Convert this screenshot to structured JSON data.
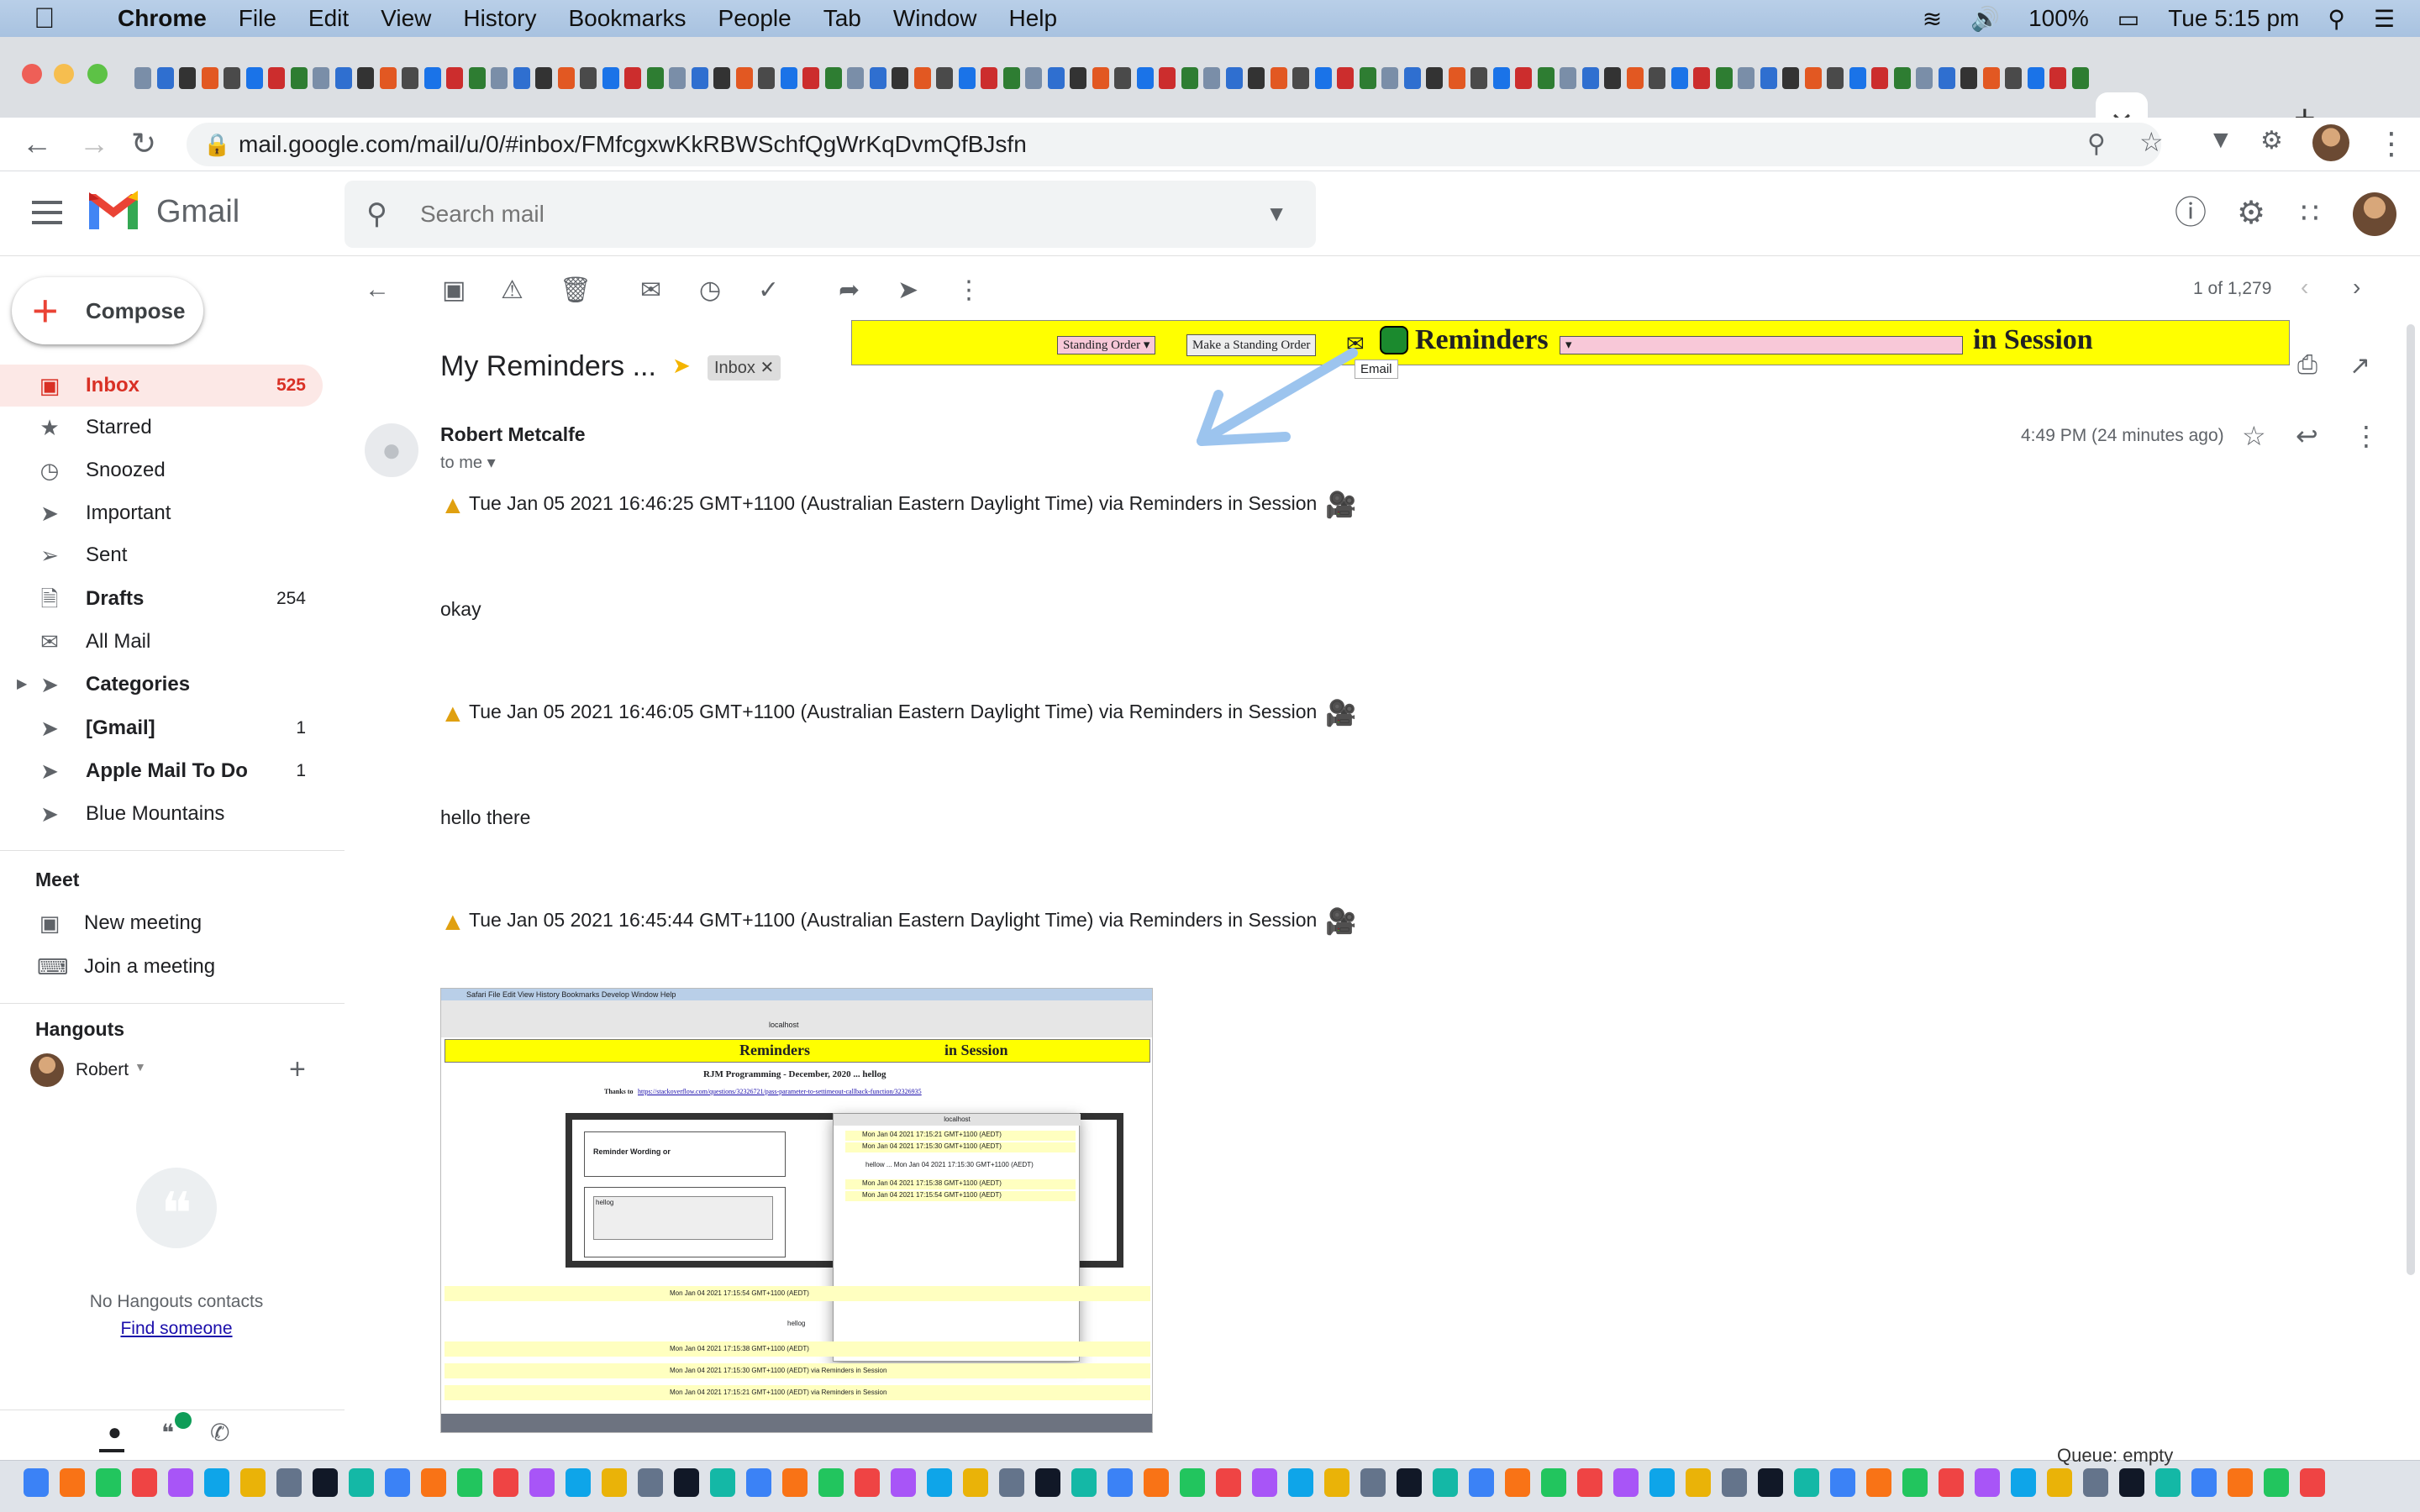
{
  "menubar": {
    "app": "Chrome",
    "items": [
      "File",
      "Edit",
      "View",
      "History",
      "Bookmarks",
      "People",
      "Tab",
      "Window",
      "Help"
    ],
    "battery": "100%",
    "clock": "Tue 5:15 pm"
  },
  "browser": {
    "url": "mail.google.com/mail/u/0/#inbox/FMfcgxwKkRBWSchfQgWrKqDvmQfBJsfn"
  },
  "gmail": {
    "brand": "Gmail",
    "search_placeholder": "Search mail",
    "compose": "Compose",
    "nav": [
      {
        "label": "Inbox",
        "count": "525",
        "icon": "inbox-icon"
      },
      {
        "label": "Starred",
        "count": "",
        "icon": "star-icon"
      },
      {
        "label": "Snoozed",
        "count": "",
        "icon": "clock-icon"
      },
      {
        "label": "Important",
        "count": "",
        "icon": "label-important-icon"
      },
      {
        "label": "Sent",
        "count": "",
        "icon": "send-icon"
      },
      {
        "label": "Drafts",
        "count": "254",
        "icon": "draft-icon"
      },
      {
        "label": "All Mail",
        "count": "",
        "icon": "mail-icon"
      },
      {
        "label": "Categories",
        "count": "",
        "icon": "label-icon"
      },
      {
        "label": "[Gmail]",
        "count": "1",
        "icon": "label-icon"
      },
      {
        "label": "Apple Mail To Do",
        "count": "1",
        "icon": "label-icon"
      },
      {
        "label": "Blue Mountains",
        "count": "",
        "icon": "label-icon"
      }
    ],
    "meet": {
      "heading": "Meet",
      "new_meeting": "New meeting",
      "join_meeting": "Join a meeting"
    },
    "hangouts": {
      "heading": "Hangouts",
      "user": "Robert",
      "empty": "No Hangouts contacts",
      "find": "Find someone"
    },
    "pager": "1 of 1,279"
  },
  "message": {
    "subject": "My Reminders ...",
    "label_chip": "Inbox",
    "sender": "Robert Metcalfe",
    "to": "to me",
    "time": "4:49 PM (24 minutes ago)",
    "entries": [
      {
        "stamp": "Tue Jan 05 2021 16:46:25 GMT+1100 (Australian Eastern Daylight Time) via Reminders in Session",
        "text": "okay"
      },
      {
        "stamp": "Tue Jan 05 2021 16:46:05 GMT+1100 (Australian Eastern Daylight Time) via Reminders in Session",
        "text": "hello there"
      },
      {
        "stamp": "Tue Jan 05 2021 16:45:44 GMT+1100 (Australian Eastern Daylight Time) via Reminders in Session",
        "text": ""
      }
    ]
  },
  "banner": {
    "select1": "Standing Order",
    "button": "Make a Standing Order",
    "title_left": "Reminders",
    "title_right": "in Session",
    "tooltip": "Email"
  },
  "embedded": {
    "menubar": "Safari  File  Edit  View  History  Bookmarks  Develop  Window  Help",
    "url": "localhost",
    "title_left": "Reminders",
    "title_right": "in Session",
    "heading": "RJM Programming - December, 2020 ... hellog",
    "thanks": "Thanks to",
    "thanks_link": "https://stackoverflow.com/questions/32326721/pass-parameter-to-settimeout-callback-function/32326935",
    "wording_label": "Reminder Wording or",
    "textarea": "hellog",
    "popup_title": "localhost",
    "popup_rows": [
      "Mon Jan 04 2021 17:15:21 GMT+1100 (AEDT)",
      "Mon Jan 04 2021 17:15:30 GMT+1100 (AEDT)",
      "hellow ... Mon Jan 04 2021 17:15:30 GMT+1100 (AEDT)",
      "Mon Jan 04 2021 17:15:38 GMT+1100 (AEDT)",
      "Mon Jan 04 2021 17:15:54 GMT+1100 (AEDT)"
    ],
    "list_rows": [
      "Mon Jan 04 2021 17:15:54 GMT+1100 (AEDT)",
      "hellog",
      "Mon Jan 04 2021 17:15:38 GMT+1100 (AEDT)",
      "Mon Jan 04 2021 17:15:30 GMT+1100 (AEDT) via Reminders in Session",
      "Mon Jan 04 2021 17:15:21 GMT+1100 (AEDT) via Reminders in Session"
    ]
  },
  "dock": {
    "queue": "Queue: empty"
  },
  "colors": {
    "accent": "#d93025",
    "banner": "#ffff00",
    "menubar": "#b0c8e4"
  }
}
